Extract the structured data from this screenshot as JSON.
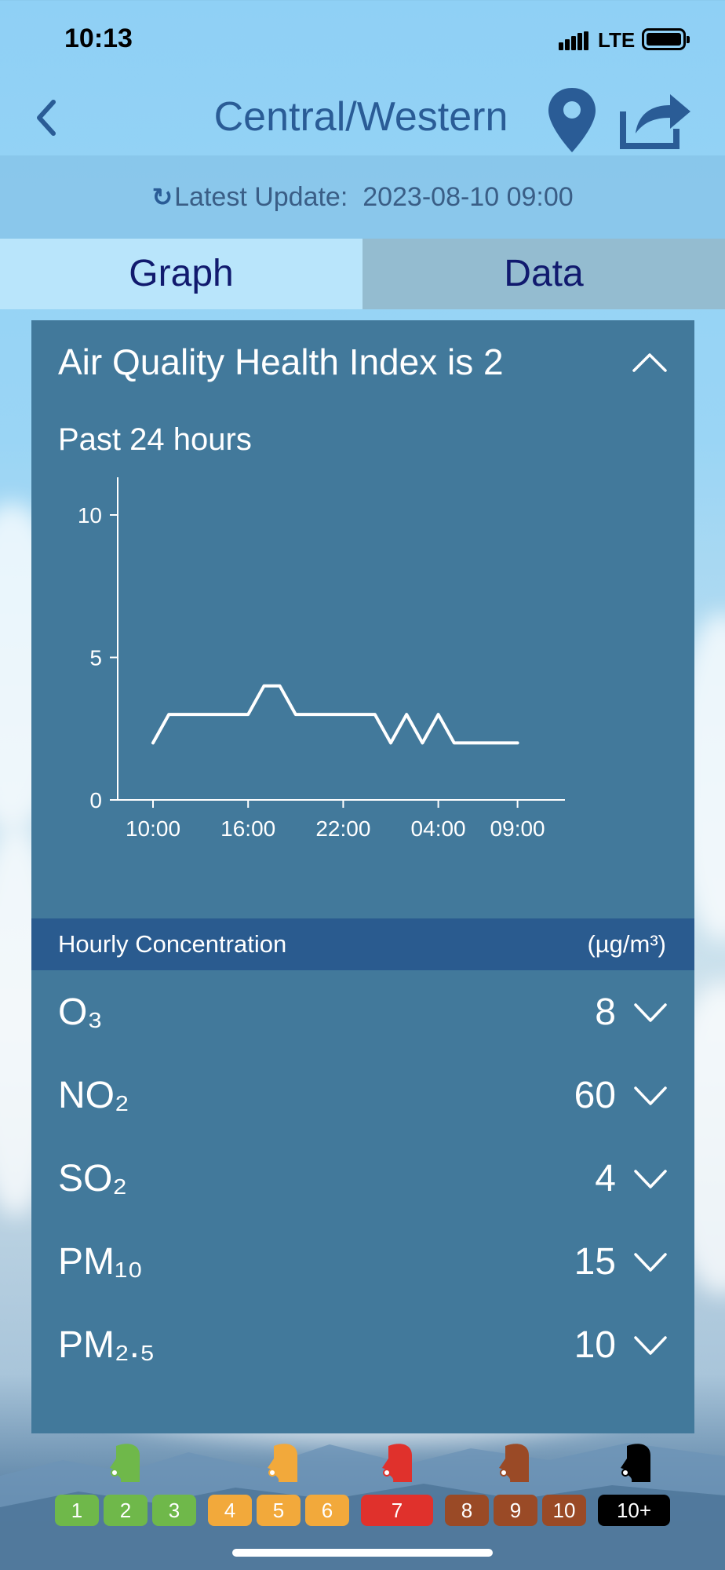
{
  "status_bar": {
    "time": "10:13",
    "network": "LTE"
  },
  "nav": {
    "title": "Central/Western",
    "back_icon": "chevron-left-icon",
    "location_icon": "map-pin-icon",
    "share_icon": "share-icon"
  },
  "update": {
    "label": "Latest Update:",
    "timestamp": "2023-08-10 09:00",
    "icon": "refresh-icon"
  },
  "tabs": [
    {
      "label": "Graph",
      "selected": true
    },
    {
      "label": "Data",
      "selected": false
    }
  ],
  "card": {
    "title": "Air Quality Health Index is 2",
    "subtitle": "Past 24 hours"
  },
  "chart_data": {
    "type": "line",
    "x_tick_labels": [
      "10:00",
      "16:00",
      "22:00",
      "04:00",
      "09:00"
    ],
    "y_ticks": [
      0,
      5,
      10
    ],
    "ylim": [
      0,
      10
    ],
    "x": [
      "10:00",
      "11:00",
      "12:00",
      "13:00",
      "14:00",
      "15:00",
      "16:00",
      "17:00",
      "18:00",
      "19:00",
      "20:00",
      "21:00",
      "22:00",
      "23:00",
      "00:00",
      "01:00",
      "02:00",
      "03:00",
      "04:00",
      "05:00",
      "06:00",
      "07:00",
      "08:00",
      "09:00"
    ],
    "values": [
      2,
      3,
      3,
      3,
      3,
      3,
      3,
      4,
      4,
      3,
      3,
      3,
      3,
      3,
      3,
      2,
      3,
      2,
      3,
      2,
      2,
      2,
      2,
      2
    ],
    "grid": false,
    "color": "#ffffff"
  },
  "concentration": {
    "title": "Hourly Concentration",
    "unit": "(µg/m³)",
    "items": [
      {
        "name": "O₃",
        "value": "8"
      },
      {
        "name": "NO₂",
        "value": "60"
      },
      {
        "name": "SO₂",
        "value": "4"
      },
      {
        "name": "PM₁₀",
        "value": "15"
      },
      {
        "name": "PM₂.₅",
        "value": "10"
      }
    ]
  },
  "legend": {
    "levels": [
      "1",
      "2",
      "3",
      "4",
      "5",
      "6",
      "7",
      "8",
      "9",
      "10",
      "10+"
    ],
    "colors": {
      "low": "#6fb84a",
      "moderate": "#f2a93b",
      "high": "#e0312c",
      "very_high": "#9a4a26",
      "serious": "#000000"
    },
    "face_icons": [
      "face-low-icon",
      "face-moderate-icon",
      "face-high-icon",
      "face-very-high-icon",
      "face-serious-icon"
    ]
  }
}
